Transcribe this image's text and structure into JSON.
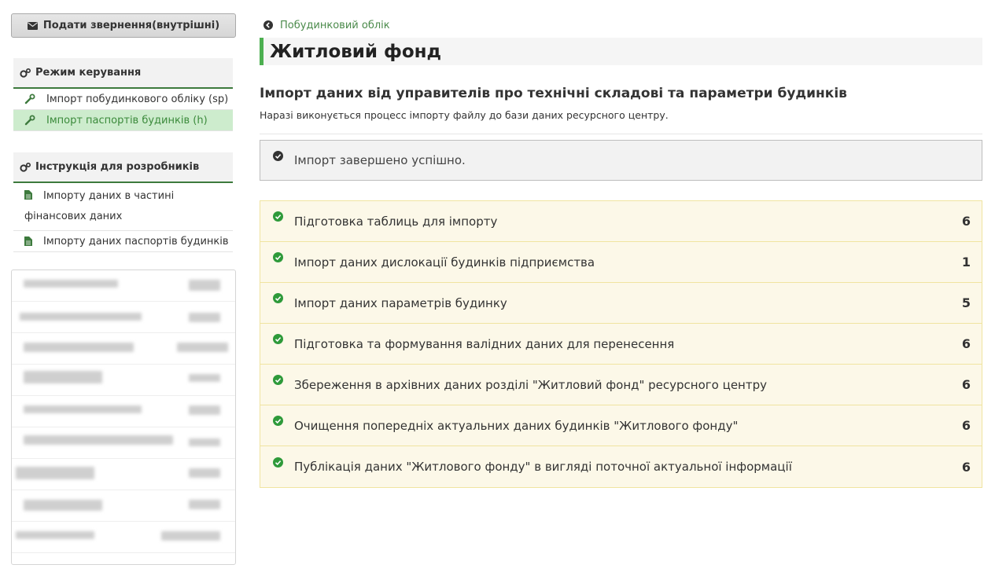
{
  "sidebar": {
    "appeal_button": "Подати звернення(внутрішні)",
    "control_panel": {
      "title": "Режим керування",
      "items": [
        {
          "label": "Імпорт побудинкового обліку (sp)"
        },
        {
          "label": "Імпорт паспортів будинків (h)"
        }
      ]
    },
    "dev_panel": {
      "title": "Інструкція для розробників",
      "items": [
        {
          "label": "Імпорту даних в частині фінансових даних"
        },
        {
          "label": "Імпорту даних паспортів будинків"
        }
      ]
    }
  },
  "main": {
    "breadcrumb": "Побудинковий облік",
    "page_title": "Житловий фонд",
    "section_title": "Імпорт даних від управителів про технічні складові та параметри будинків",
    "section_subtitle": "Наразі виконується процесс імпорту файлу до бази даних ресурсного центру.",
    "status": "Імпорт завершено успішно.",
    "steps": [
      {
        "label": "Підготовка таблиць для імпорту",
        "count": "6"
      },
      {
        "label": "Імпорт даних дислокації будинків підприємства",
        "count": "1"
      },
      {
        "label": "Імпорт даних параметрів будинку",
        "count": "5"
      },
      {
        "label": "Підготовка та формування валідних даних для перенесення",
        "count": "6"
      },
      {
        "label": "Збереження в архівних даних розділі \"Житловий фонд\" ресурсного центру",
        "count": "6"
      },
      {
        "label": "Очищення попередніх актуальних даних будинків \"Житлового фонду\"",
        "count": "6"
      },
      {
        "label": "Публікація даних \"Житлового фонду\" в вигляді поточної актуальної інформації",
        "count": "6"
      }
    ]
  },
  "colors": {
    "accent_green": "#4caf50",
    "active_item_bg": "#cdeccd",
    "step_bg": "#fcf8e8"
  }
}
